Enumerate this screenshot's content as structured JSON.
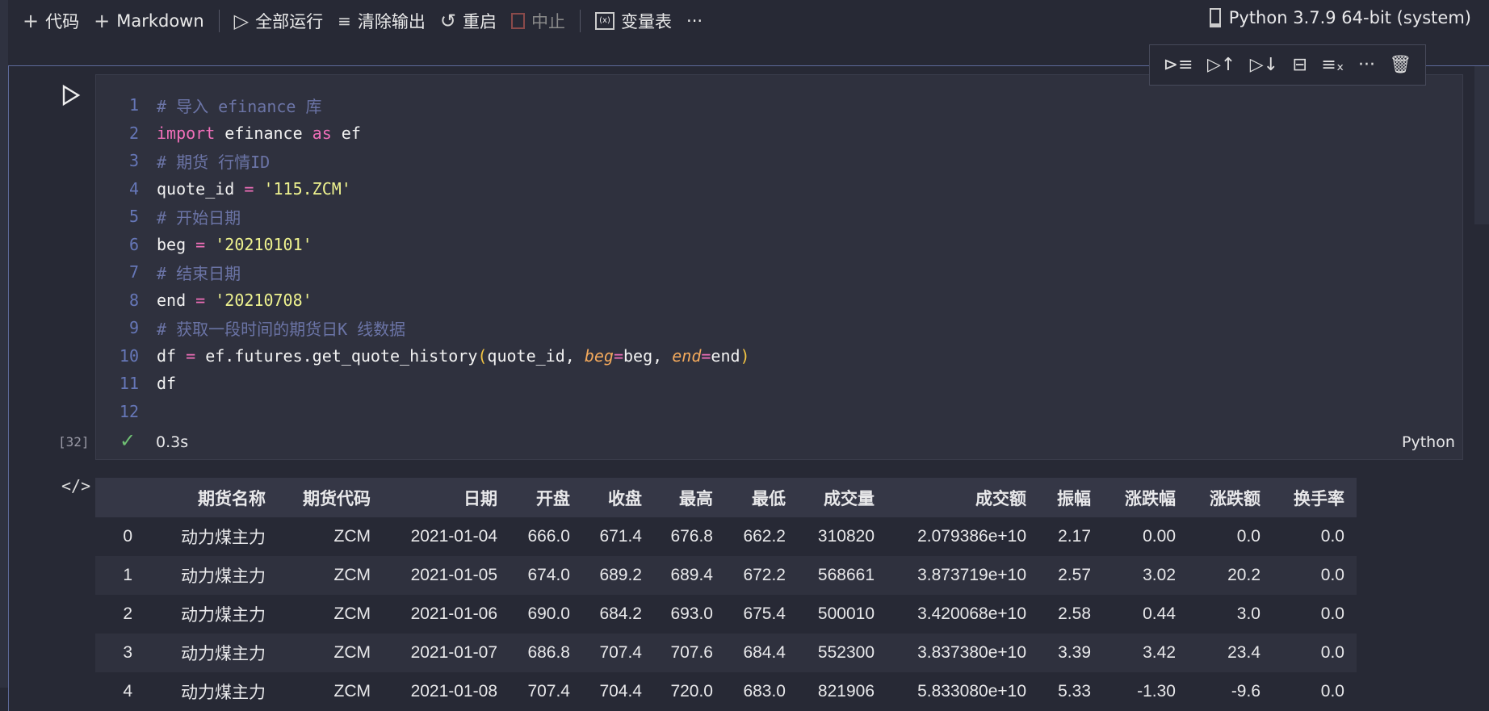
{
  "toolbar": {
    "add_code": "代码",
    "add_markdown": "Markdown",
    "run_all": "全部运行",
    "clear_output": "清除输出",
    "restart": "重启",
    "interrupt": "中止",
    "variables": "变量表",
    "more": "···",
    "kernel": "Python 3.7.9 64-bit (system)"
  },
  "cell": {
    "lines": [
      [
        {
          "t": "comment",
          "v": "# 导入 efinance 库"
        }
      ],
      [
        {
          "t": "kw",
          "v": "import"
        },
        {
          "t": "id",
          "v": " efinance "
        },
        {
          "t": "kw",
          "v": "as"
        },
        {
          "t": "id",
          "v": " ef"
        }
      ],
      [
        {
          "t": "comment",
          "v": "# 期货 行情ID"
        }
      ],
      [
        {
          "t": "id",
          "v": "quote_id "
        },
        {
          "t": "op",
          "v": "="
        },
        {
          "t": "id",
          "v": " "
        },
        {
          "t": "str",
          "v": "'115.ZCM'"
        }
      ],
      [
        {
          "t": "comment",
          "v": "# 开始日期"
        }
      ],
      [
        {
          "t": "id",
          "v": "beg "
        },
        {
          "t": "op",
          "v": "="
        },
        {
          "t": "id",
          "v": " "
        },
        {
          "t": "str",
          "v": "'20210101'"
        }
      ],
      [
        {
          "t": "comment",
          "v": "# 结束日期"
        }
      ],
      [
        {
          "t": "id",
          "v": "end "
        },
        {
          "t": "op",
          "v": "="
        },
        {
          "t": "id",
          "v": " "
        },
        {
          "t": "str",
          "v": "'20210708'"
        }
      ],
      [
        {
          "t": "comment",
          "v": "# 获取一段时间的期货日K 线数据"
        }
      ],
      [
        {
          "t": "id",
          "v": "df "
        },
        {
          "t": "op",
          "v": "="
        },
        {
          "t": "id",
          "v": " ef.futures.get_quote_history"
        },
        {
          "t": "brk",
          "v": "("
        },
        {
          "t": "id",
          "v": "quote_id, "
        },
        {
          "t": "param",
          "v": "beg"
        },
        {
          "t": "op",
          "v": "="
        },
        {
          "t": "id",
          "v": "beg, "
        },
        {
          "t": "param",
          "v": "end"
        },
        {
          "t": "op",
          "v": "="
        },
        {
          "t": "id",
          "v": "end"
        },
        {
          "t": "brk",
          "v": ")"
        }
      ],
      [
        {
          "t": "id",
          "v": "df"
        }
      ],
      []
    ],
    "exec_count": "[32]",
    "duration": "0.3s",
    "language": "Python"
  },
  "output": {
    "columns": [
      "",
      "期货名称",
      "期货代码",
      "日期",
      "开盘",
      "收盘",
      "最高",
      "最低",
      "成交量",
      "成交额",
      "振幅",
      "涨跌幅",
      "涨跌额",
      "换手率"
    ],
    "rows": [
      [
        "0",
        "动力煤主力",
        "ZCM",
        "2021-01-04",
        "666.0",
        "671.4",
        "676.8",
        "662.2",
        "310820",
        "2.079386e+10",
        "2.17",
        "0.00",
        "0.0",
        "0.0"
      ],
      [
        "1",
        "动力煤主力",
        "ZCM",
        "2021-01-05",
        "674.0",
        "689.2",
        "689.4",
        "672.2",
        "568661",
        "3.873719e+10",
        "2.57",
        "3.02",
        "20.2",
        "0.0"
      ],
      [
        "2",
        "动力煤主力",
        "ZCM",
        "2021-01-06",
        "690.0",
        "684.2",
        "693.0",
        "675.4",
        "500010",
        "3.420068e+10",
        "2.58",
        "0.44",
        "3.0",
        "0.0"
      ],
      [
        "3",
        "动力煤主力",
        "ZCM",
        "2021-01-07",
        "686.8",
        "707.4",
        "707.6",
        "684.4",
        "552300",
        "3.837380e+10",
        "3.39",
        "3.42",
        "23.4",
        "0.0"
      ],
      [
        "4",
        "动力煤主力",
        "ZCM",
        "2021-01-08",
        "707.4",
        "704.4",
        "720.0",
        "683.0",
        "821906",
        "5.833080e+10",
        "5.33",
        "-1.30",
        "-9.6",
        "0.0"
      ]
    ]
  }
}
